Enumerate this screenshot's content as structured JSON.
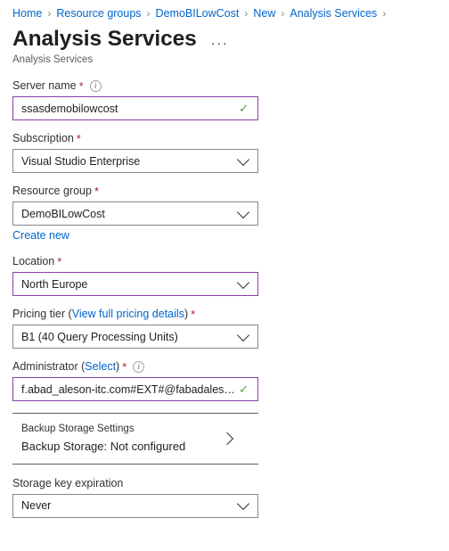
{
  "breadcrumb": {
    "separator": "›",
    "items": [
      {
        "label": "Home"
      },
      {
        "label": "Resource groups"
      },
      {
        "label": "DemoBILowCost"
      },
      {
        "label": "New"
      },
      {
        "label": "Analysis Services"
      }
    ]
  },
  "header": {
    "title": "Analysis Services",
    "subtitle": "Analysis Services",
    "more_label": "···"
  },
  "form": {
    "server_name": {
      "label": "Server name",
      "required": "*",
      "info": "i",
      "value": "ssasdemobilowcost",
      "valid_mark": "✓"
    },
    "subscription": {
      "label": "Subscription",
      "required": "*",
      "value": "Visual Studio Enterprise"
    },
    "resource_group": {
      "label": "Resource group",
      "required": "*",
      "value": "DemoBILowCost",
      "create_new": "Create new"
    },
    "location": {
      "label": "Location",
      "required": "*",
      "value": "North Europe"
    },
    "pricing_tier": {
      "label_prefix": "Pricing tier",
      "paren_open": "(",
      "link": "View full pricing details",
      "paren_close": ")",
      "required": "*",
      "value": "B1 (40 Query Processing Units)"
    },
    "administrator": {
      "label_prefix": "Administrator",
      "paren_open": "(",
      "link": "Select",
      "paren_close": ")",
      "required": "*",
      "info": "i",
      "value": "f.abad_aleson-itc.com#EXT#@fabadales…",
      "valid_mark": "✓"
    },
    "backup_storage": {
      "heading": "Backup Storage Settings",
      "status": "Backup Storage: Not configured"
    },
    "storage_key_expiration": {
      "label": "Storage key expiration",
      "value": "Never"
    }
  },
  "colors": {
    "link": "#0066cc",
    "required": "#a4262c",
    "focus_border": "#8a3ea8",
    "valid_green": "#4c9c2e",
    "border": "#8a8886"
  }
}
